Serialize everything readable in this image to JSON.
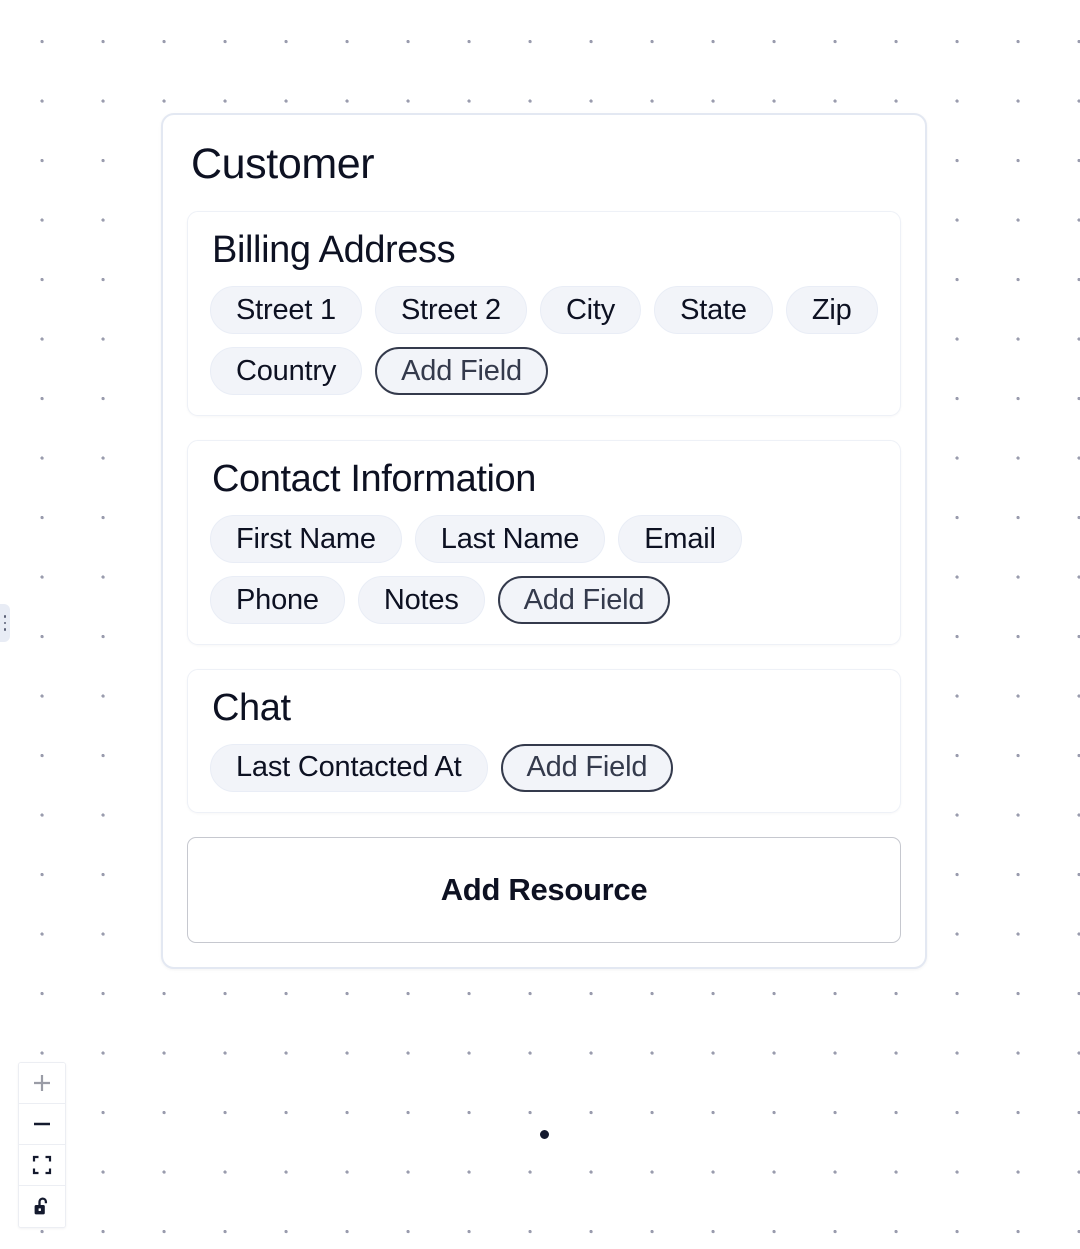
{
  "canvas": {
    "background_color": "#ffffff",
    "dot_color": "#9a9cae",
    "dot_spacing_px": 61
  },
  "edge_handle": {
    "name": "node-drag-handle",
    "icon": "grip-dots-vertical-icon"
  },
  "node": {
    "title": "Customer",
    "border_color": "#e3e8f2",
    "sections": [
      {
        "title": "Billing Address",
        "fields": [
          "Street 1",
          "Street 2",
          "City",
          "State",
          "Zip",
          "Country"
        ],
        "add_field_label": "Add Field"
      },
      {
        "title": "Contact Information",
        "fields": [
          "First Name",
          "Last Name",
          "Email",
          "Phone",
          "Notes"
        ],
        "add_field_label": "Add Field"
      },
      {
        "title": "Chat",
        "fields": [
          "Last Contacted At"
        ],
        "add_field_label": "Add Field"
      }
    ],
    "add_resource_label": "Add Resource",
    "bottom_handle": "connection-handle"
  },
  "view_controls": {
    "zoom_in": {
      "label": "+",
      "icon": "plus-icon",
      "disabled": true,
      "color": "#9a9ca6"
    },
    "zoom_out": {
      "label": "−",
      "icon": "minus-icon",
      "disabled": false,
      "color": "#141a2e"
    },
    "fit_view": {
      "icon": "fit-screen-icon",
      "color": "#141a2e"
    },
    "lock": {
      "icon": "unlock-icon",
      "color": "#141a2e"
    }
  }
}
